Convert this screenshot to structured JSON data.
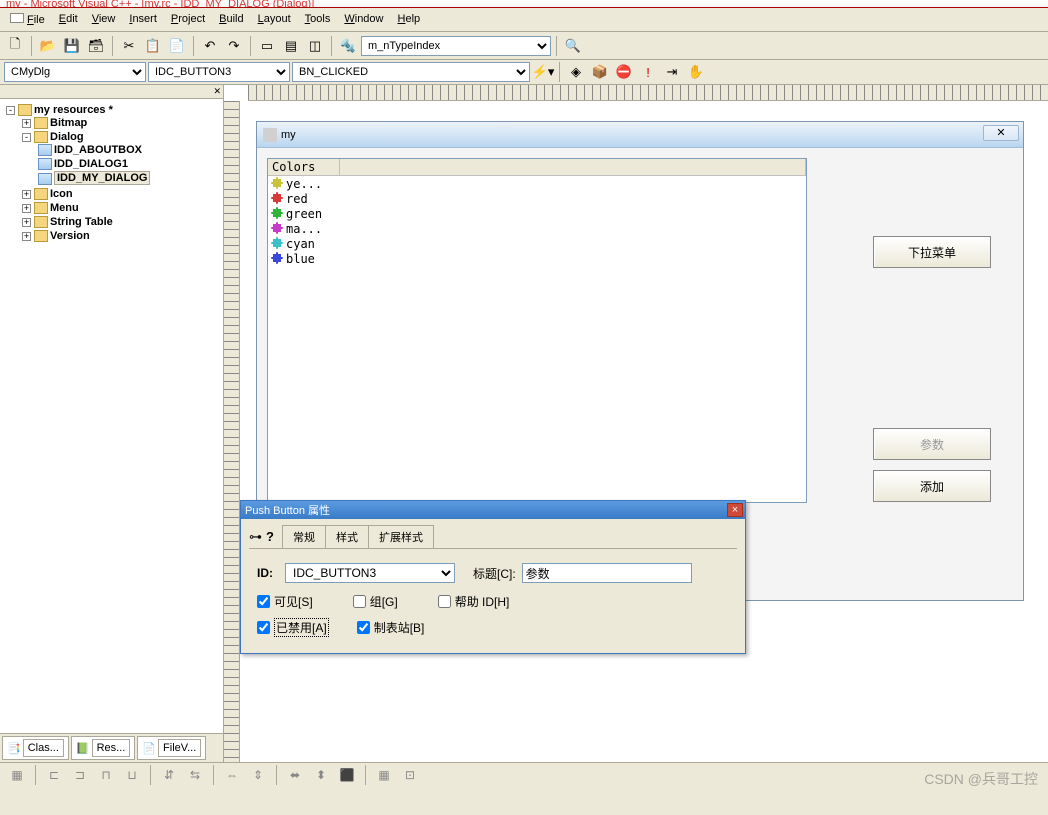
{
  "window_title": "my - Microsoft Visual C++ - [my.rc - IDD_MY_DIALOG (Dialog)]",
  "menu": {
    "file": "File",
    "edit": "Edit",
    "view": "View",
    "insert": "Insert",
    "project": "Project",
    "build": "Build",
    "layout": "Layout",
    "tools": "Tools",
    "window": "Window",
    "help": "Help"
  },
  "toolbar1": {
    "combo_search": "m_nTypeIndex"
  },
  "toolbar2": {
    "class": "CMyDlg",
    "id": "IDC_BUTTON3",
    "msg": "BN_CLICKED"
  },
  "tree": {
    "root": "my resources *",
    "bitmap": "Bitmap",
    "dialog": "Dialog",
    "dlg_about": "IDD_ABOUTBOX",
    "dlg_1": "IDD_DIALOG1",
    "dlg_my": "IDD_MY_DIALOG",
    "icon": "Icon",
    "menu": "Menu",
    "strtab": "String Table",
    "version": "Version"
  },
  "tabs": {
    "class": "Clas...",
    "res": "Res...",
    "file": "FileV..."
  },
  "dialog_preview": {
    "title": "my",
    "list_header": "Colors",
    "colors": [
      {
        "name": "ye...",
        "fill": "#c9c43a"
      },
      {
        "name": "red",
        "fill": "#d83a3a"
      },
      {
        "name": "green",
        "fill": "#2fb53a"
      },
      {
        "name": "ma...",
        "fill": "#c83ac8"
      },
      {
        "name": "cyan",
        "fill": "#3ac0c8"
      },
      {
        "name": "blue",
        "fill": "#3a4ad8"
      }
    ],
    "btn_dropdown": "下拉菜单",
    "btn_param": "参数",
    "btn_add": "添加"
  },
  "props": {
    "title": "Push Button 属性",
    "tab_general": "常规",
    "tab_style": "样式",
    "tab_ext": "扩展样式",
    "lbl_id": "ID:",
    "val_id": "IDC_BUTTON3",
    "lbl_caption": "标题[C]:",
    "val_caption": "参数",
    "chk_visible": "可见[S]",
    "chk_group": "组[G]",
    "chk_helpid": "帮助 ID[H]",
    "chk_disabled": "已禁用[A]",
    "chk_tabstop": "制表站[B]"
  },
  "watermark": "CSDN @兵哥工控"
}
